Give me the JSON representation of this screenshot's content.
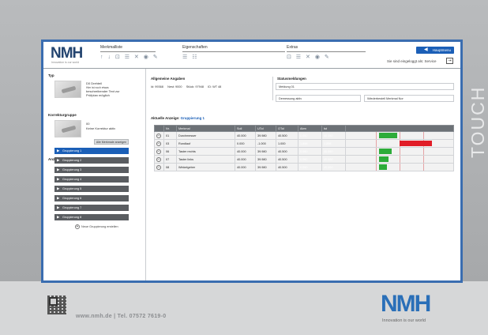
{
  "brand": {
    "logo": "NMH",
    "slogan_small": "Innovation is our world",
    "accent": "#1b5fb7",
    "logo_color": "#23446f"
  },
  "side_label": "TOUCH",
  "header": {
    "groups": [
      {
        "title": "Merkmalliste",
        "icons": "↑ ↓ ⊡ ☰ ✕ ◉ ✎"
      },
      {
        "title": "Eigenschaften",
        "icons": "☰ ☷"
      },
      {
        "title": "Extras",
        "icons": "⊡ ☰ ✕ ◉ ✎"
      }
    ],
    "home_button": "Hauptmenu",
    "login_text": "Sie sind eingeloggt als: Service",
    "logout_icon": "⇥"
  },
  "left": {
    "typ_title": "Typ",
    "typ_lines": [
      "D0 Drehteil",
      "Hier ist noch etwas",
      "beschreibender Text zur",
      "Prüfplan möglich"
    ],
    "korr_title": "Korrekturgruppe",
    "korr_lines": [
      "00",
      "Keine Korrektur aktiv"
    ],
    "anzeige_title": "Anzeige Gruppierungen",
    "alle_button": "Alle Merkmale anzeigen",
    "groups": [
      "Gruppierung 1",
      "Gruppierung 2",
      "Gruppierung 3",
      "Gruppierung 4",
      "Gruppierung 5",
      "Gruppierung 6",
      "Gruppierung 7",
      "Gruppierung 8"
    ],
    "new_group": "Neue Gruppierung erstellen"
  },
  "general": {
    "title": "Allgemeine Angaben",
    "fields": [
      "Id: 99368",
      "Nest: 9000",
      "Stück: 97948",
      "ID: WT 48"
    ]
  },
  "status": {
    "title": "Statusmeldungen",
    "meldung": "Meldung 01",
    "demess": "Demessung aktiv",
    "wiederholung": "Wiederbestell Merkmal Nor"
  },
  "current": {
    "label": "Aktuelle Anzeige:",
    "value": "Gruppierung 1"
  },
  "table": {
    "headers": [
      "",
      "Nr.",
      "Merkmal",
      "Soll",
      "UTol",
      "OTol",
      "Abm",
      "Ist",
      ""
    ],
    "rows": [
      {
        "nr": "01",
        "name": "Durchmesser",
        "soll": "40.000",
        "utol": "39.980",
        "otol": "40.500",
        "abm": "0.060",
        "ist": "40.060",
        "status": "ok",
        "bar": 0.28
      },
      {
        "nr": "03",
        "name": "Rundlauf",
        "soll": "0.000",
        "utol": "-1.000",
        "otol": "1.000",
        "abm": "1.898",
        "ist": "1.898",
        "status": "bad",
        "bar": 0.95
      },
      {
        "nr": "06",
        "name": "Taster rechts",
        "soll": "40.000",
        "utol": "39.980",
        "otol": "40.500",
        "abm": "0.060",
        "ist": "40.060",
        "status": "ok",
        "bar": 0.2
      },
      {
        "nr": "07",
        "name": "Taster links",
        "soll": "40.000",
        "utol": "39.980",
        "otol": "40.500",
        "abm": "0.060",
        "ist": "40.060",
        "status": "ok",
        "bar": 0.15
      },
      {
        "nr": "08",
        "name": "Winkelgeber",
        "soll": "40.000",
        "utol": "39.980",
        "otol": "40.500",
        "abm": "0.060",
        "ist": "40.060",
        "status": "ok",
        "bar": 0.12
      }
    ]
  },
  "footer": {
    "contact": "www.nmh.de | Tel. 07572 7619-0",
    "logo": "NMH",
    "slogan": "Innovation is our world"
  }
}
